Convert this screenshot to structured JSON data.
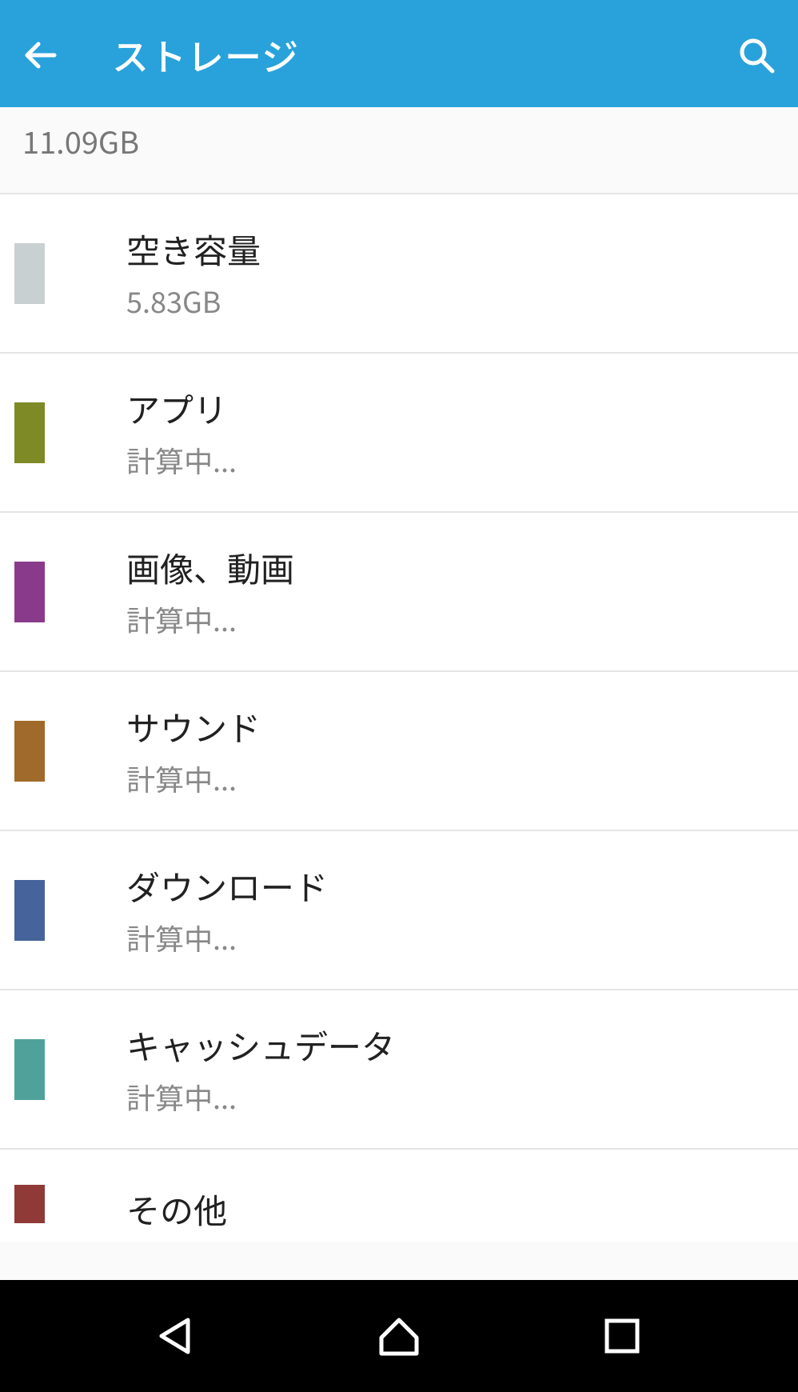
{
  "header": {
    "title": "ストレージ",
    "back_icon": "back-arrow",
    "search_icon": "search"
  },
  "total": "11.09GB",
  "categories": [
    {
      "label": "空き容量",
      "value": "5.83GB",
      "color": "#c9d0d2"
    },
    {
      "label": "アプリ",
      "value": "計算中...",
      "color": "#7d8a25"
    },
    {
      "label": "画像、動画",
      "value": "計算中...",
      "color": "#8a3a8a"
    },
    {
      "label": "サウンド",
      "value": "計算中...",
      "color": "#a06a2b"
    },
    {
      "label": "ダウンロード",
      "value": "計算中...",
      "color": "#46649b"
    },
    {
      "label": "キャッシュデータ",
      "value": "計算中...",
      "color": "#4fa29a"
    },
    {
      "label": "その他",
      "value": "",
      "color": "#8f3a36"
    }
  ],
  "nav": {
    "back": "triangle-back",
    "home": "home",
    "recent": "square"
  }
}
